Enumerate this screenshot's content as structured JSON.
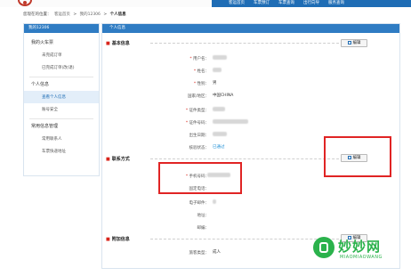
{
  "top_nav": {
    "items": [
      "客运首页",
      "车票预订",
      "车票查询",
      "出行向导",
      "服务查询"
    ]
  },
  "breadcrumb": {
    "prefix": "您现在的位置：",
    "home": "客运首页",
    "sep": ">",
    "mine": "我的12306",
    "current": "个人信息"
  },
  "sidebar": {
    "header": "我的12306",
    "sections": [
      {
        "title": "我的火车票",
        "items": [
          "未完成订单",
          "已完成订单(改/退)"
        ]
      },
      {
        "title": "个人信息",
        "items": [
          "查看个人信息",
          "账号安全"
        ]
      },
      {
        "title": "常用信息管理",
        "items": [
          "常用联系人",
          "车票快递地址"
        ]
      }
    ],
    "active_item": "查看个人信息"
  },
  "main": {
    "header": "个人信息",
    "basic": {
      "title": "基本信息",
      "edit_label": "编辑",
      "fields": [
        {
          "label": "用户名：",
          "required": true,
          "value": ""
        },
        {
          "label": "姓名：",
          "required": true,
          "value": ""
        },
        {
          "label": "性别：",
          "required": true,
          "value": "男"
        },
        {
          "label": "国家/地区：",
          "required": false,
          "value": "中国CHINA"
        },
        {
          "label": "证件类型：",
          "required": true,
          "value": ""
        },
        {
          "label": "证件号码：",
          "required": true,
          "value": ""
        },
        {
          "label": "出生日期：",
          "required": false,
          "value": ""
        },
        {
          "label": "核验状态：",
          "required": false,
          "value": "已通过"
        }
      ]
    },
    "contact": {
      "title": "联系方式",
      "edit_label": "编辑",
      "fields": [
        {
          "label": "手机号码：",
          "required": true,
          "value": ""
        },
        {
          "label": "固定电话：",
          "required": false,
          "value": ""
        },
        {
          "label": "电子邮件：",
          "required": false,
          "value": ""
        },
        {
          "label": "地址：",
          "required": false,
          "value": ""
        },
        {
          "label": "邮编：",
          "required": false,
          "value": ""
        }
      ]
    },
    "extra": {
      "title": "附加信息",
      "edit_label": "编辑",
      "fields": [
        {
          "label": "旅客类型：",
          "required": false,
          "value": "成人"
        }
      ]
    }
  },
  "watermark": {
    "brand": "妙妙网",
    "sub": "MIAOMIAOWANG"
  },
  "colors": {
    "nav_blue": "#1f6db5",
    "panel_head_blue": "#2f7cc3",
    "required_red": "#d9251c",
    "highlight_red": "#e02424",
    "watermark_green": "#2bb24c"
  }
}
